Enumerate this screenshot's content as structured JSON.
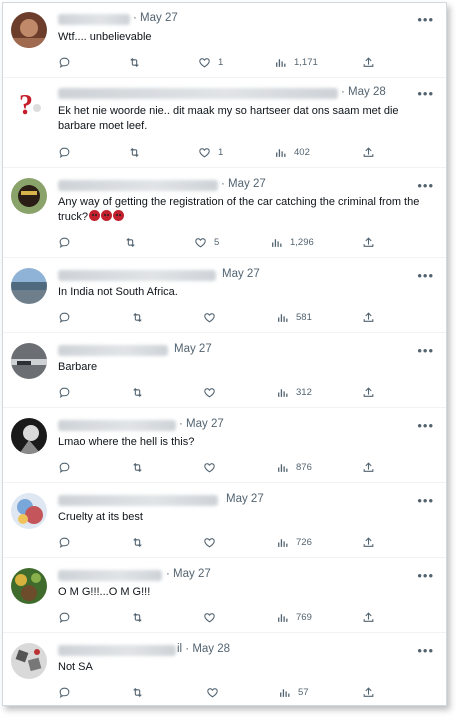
{
  "replies": [
    {
      "date": "· May 27",
      "text": "Wtf.... unbelievable",
      "stats": {
        "replies": "",
        "retweets": "",
        "likes": "1",
        "views": "1,171"
      }
    },
    {
      "date": "· May 28",
      "text": "Ek het nie woorde nie.. dit maak my so hartseer dat ons saam met die barbare moet leef.",
      "stats": {
        "replies": "",
        "retweets": "",
        "likes": "1",
        "views": "402"
      }
    },
    {
      "date": "· May 27",
      "text": "Any way of getting the registration of the car catching the criminal from the truck?",
      "emoji_count": 3,
      "stats": {
        "replies": "",
        "retweets": "",
        "likes": "5",
        "views": "1,296"
      }
    },
    {
      "date": "May 27",
      "text": "In India not South Africa.",
      "stats": {
        "replies": "",
        "retweets": "",
        "likes": "",
        "views": "581"
      }
    },
    {
      "date": "May 27",
      "text": "Barbare",
      "stats": {
        "replies": "",
        "retweets": "",
        "likes": "",
        "views": "312"
      }
    },
    {
      "date": "· May 27",
      "text": "Lmao where the hell is this?",
      "stats": {
        "replies": "",
        "retweets": "",
        "likes": "",
        "views": "876"
      }
    },
    {
      "date": "May 27",
      "text": "Cruelty at its best",
      "stats": {
        "replies": "",
        "retweets": "",
        "likes": "",
        "views": "726"
      }
    },
    {
      "date": "· May 27",
      "text": "O M G!!!...O M G!!!",
      "stats": {
        "replies": "",
        "retweets": "",
        "likes": "",
        "views": "769"
      }
    },
    {
      "date": "il · May 28",
      "text": "Not SA",
      "stats": {
        "replies": "",
        "retweets": "",
        "likes": "",
        "views": "57"
      }
    }
  ],
  "icons": {
    "more": "more-options-icon",
    "reply": "reply-icon",
    "retweet": "retweet-icon",
    "like": "like-icon",
    "views": "views-icon",
    "share": "share-icon"
  },
  "colors": {
    "text": "#0f1419",
    "muted": "#536471",
    "border": "#cfd9de",
    "emoji": "#c2202d"
  }
}
